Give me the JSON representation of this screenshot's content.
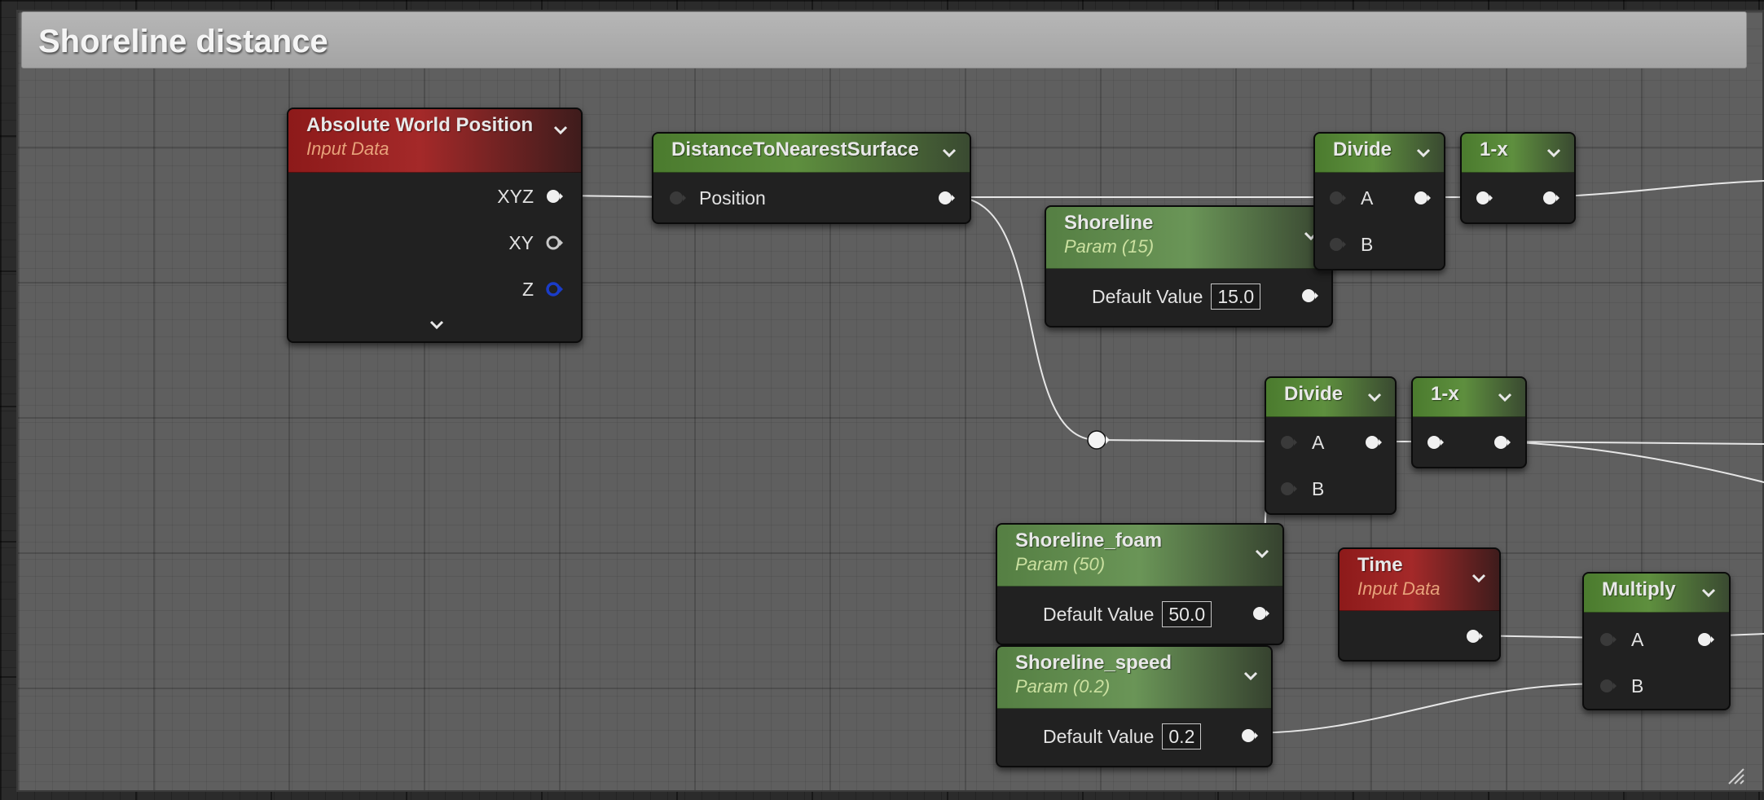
{
  "comment": {
    "title": "Shoreline distance"
  },
  "nodes": {
    "absolute_world_position": {
      "title": "Absolute World Position",
      "subtitle": "Input Data",
      "outputs": [
        "XYZ",
        "XY",
        "Z"
      ]
    },
    "distance_to_nearest_surface": {
      "title": "DistanceToNearestSurface",
      "input": "Position"
    },
    "divide_1": {
      "title": "Divide",
      "inputs": [
        "A",
        "B"
      ]
    },
    "one_minus_x_1": {
      "title": "1-x"
    },
    "shoreline": {
      "title": "Shoreline",
      "subtitle": "Param (15)",
      "default_label": "Default Value",
      "default_value": "15.0"
    },
    "divide_2": {
      "title": "Divide",
      "inputs": [
        "A",
        "B"
      ]
    },
    "one_minus_x_2": {
      "title": "1-x"
    },
    "shoreline_foam": {
      "title": "Shoreline_foam",
      "subtitle": "Param (50)",
      "default_label": "Default Value",
      "default_value": "50.0"
    },
    "time": {
      "title": "Time",
      "subtitle": "Input Data"
    },
    "multiply": {
      "title": "Multiply",
      "inputs": [
        "A",
        "B"
      ]
    },
    "shoreline_speed": {
      "title": "Shoreline_speed",
      "subtitle": "Param (0.2)",
      "default_label": "Default Value",
      "default_value": "0.2"
    }
  },
  "colors": {
    "material_node": "#5e8f3e",
    "input_data_node": "#a42929",
    "wire": "#e6e6e6",
    "pin_z": "#1a3cc8"
  },
  "icons": [
    "chevron-down-icon",
    "exec-pin-icon",
    "resize-grip-icon"
  ]
}
